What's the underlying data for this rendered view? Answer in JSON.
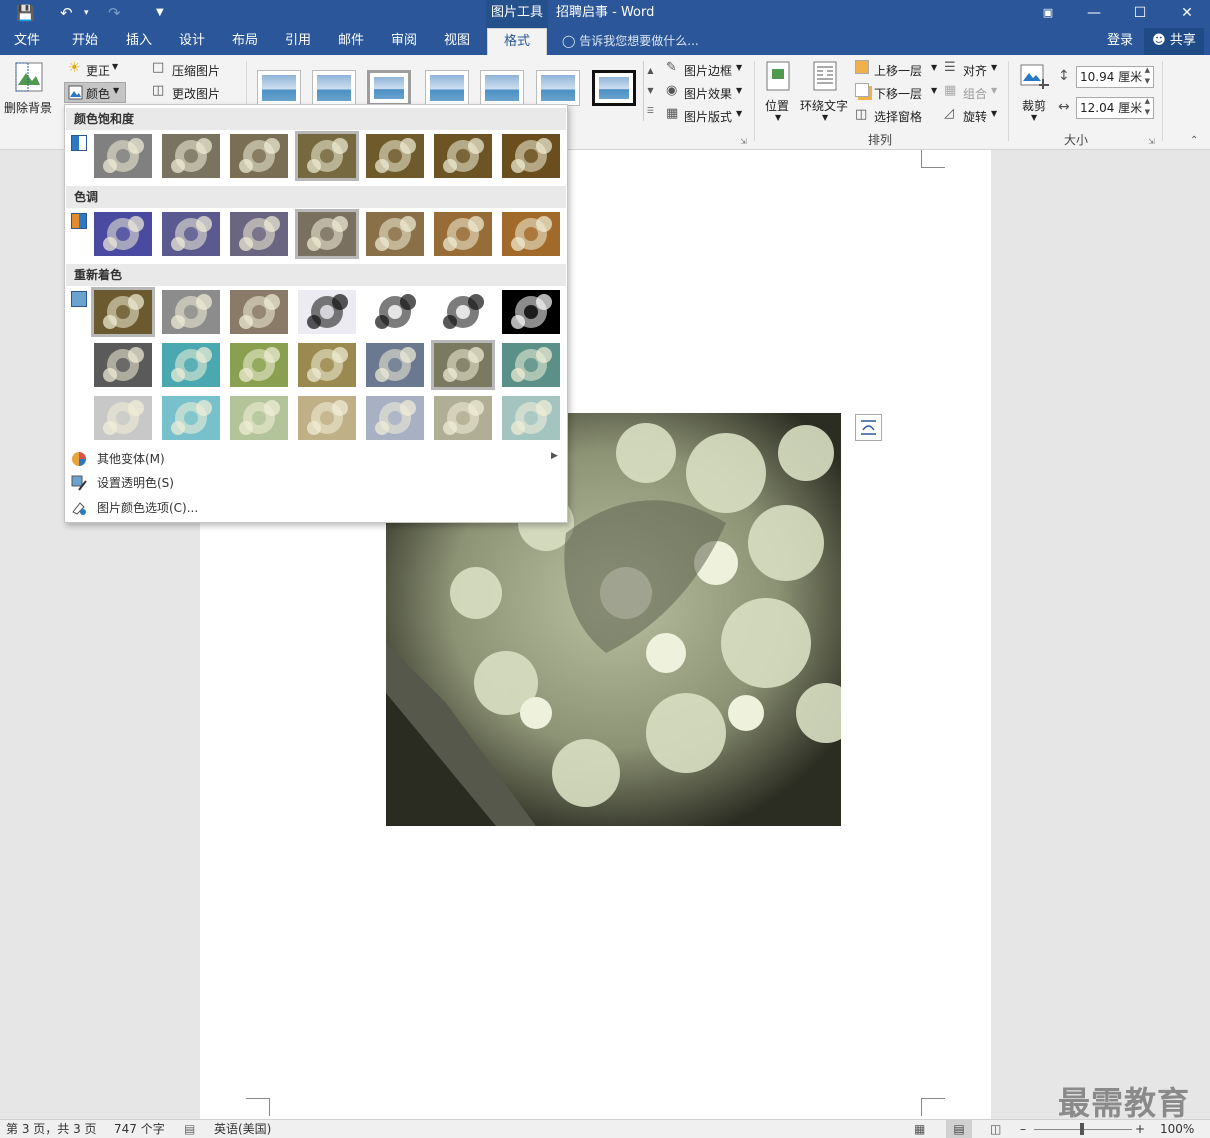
{
  "titlebar": {
    "context_tab": "图片工具",
    "title": "招聘启事 - Word"
  },
  "tabs": [
    "文件",
    "开始",
    "插入",
    "设计",
    "布局",
    "引用",
    "邮件",
    "审阅",
    "视图",
    "格式"
  ],
  "tell_me": "告诉我您想要做什么...",
  "account": {
    "login": "登录",
    "share": "共享"
  },
  "ribbon": {
    "remove_bg": "删除背景",
    "corrections": "更正",
    "color": "颜色",
    "compress": "压缩图片",
    "change_pic": "更改图片",
    "pic_border": "图片边框",
    "pic_effects": "图片效果",
    "pic_layout": "图片版式",
    "position": "位置",
    "wrap_text": "环绕文字",
    "bring_forward": "上移一层",
    "send_backward": "下移一层",
    "selection_pane": "选择窗格",
    "align": "对齐",
    "group": "组合",
    "rotate": "旋转",
    "arrange_title": "排列",
    "crop": "裁剪",
    "height": "10.94 厘米",
    "width": "12.04 厘米",
    "size_title": "大小"
  },
  "color_menu": {
    "saturation_title": "颜色饱和度",
    "tone_title": "色调",
    "recolor_title": "重新着色",
    "more_variations": "其他变体(M)",
    "set_transparent": "设置透明色(S)",
    "color_options": "图片颜色选项(C)...",
    "swatch_colors": {
      "saturation": [
        "#808080",
        "#7a7360",
        "#7a6e55",
        "#76683f",
        "#6f5a2c",
        "#6c5424",
        "#6a4e1e"
      ],
      "tone": [
        "#4a4aa0",
        "#5a5a90",
        "#6a6580",
        "#7a7060",
        "#8a7048",
        "#986c36",
        "#a26a2a"
      ],
      "recolor_row1": [
        "#6b5a2f",
        "#8c8c8c",
        "#8a7a68",
        "#ecebf2",
        "#ffffff",
        "#ffffff",
        "#000000"
      ],
      "recolor_row2": [
        "#5a5a5a",
        "#4aa8b0",
        "#8aa050",
        "#9a8a50",
        "#6a7890",
        "#7a7a60",
        "#5a9088"
      ],
      "recolor_row3": [
        "#c8c8c8",
        "#78c0cc",
        "#b4c49a",
        "#c0b088",
        "#a8b0c4",
        "#b0ae94",
        "#a4c4c0"
      ]
    }
  },
  "status": {
    "page": "第 3 页，共 3 页",
    "words": "747 个字",
    "lang": "英语(美国)",
    "zoom": "100%"
  },
  "watermark": "最需教育"
}
